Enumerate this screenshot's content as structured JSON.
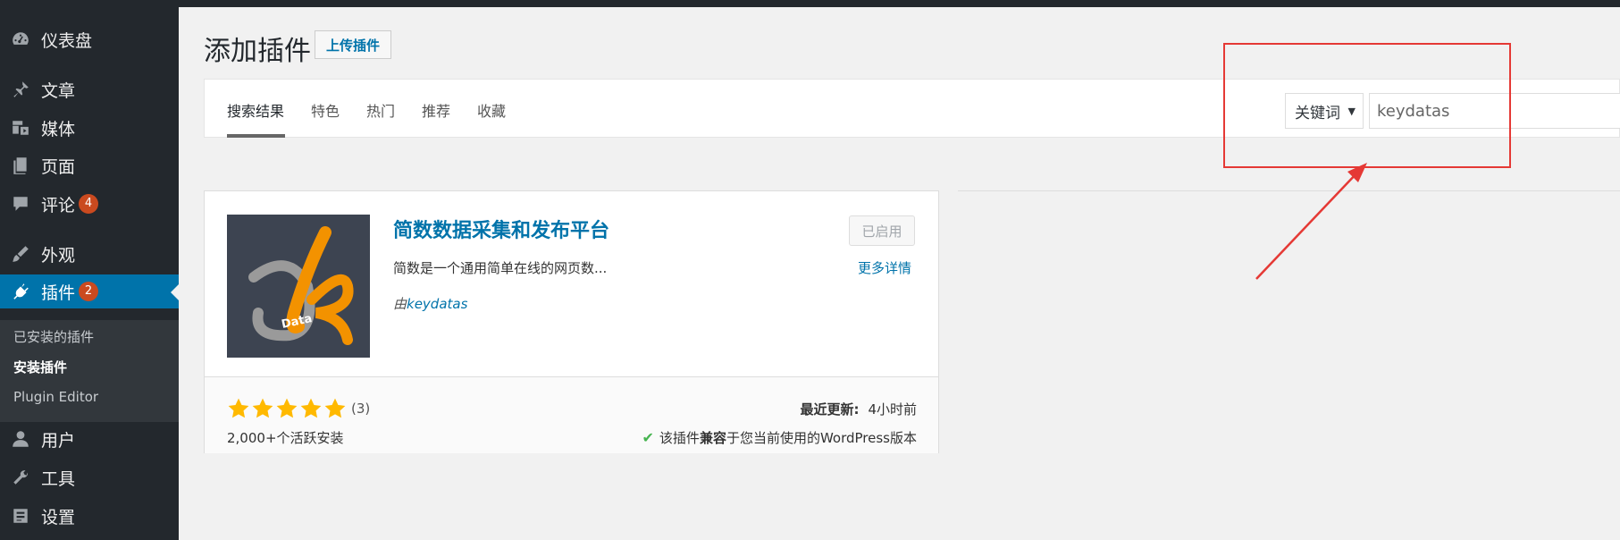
{
  "sidebar": {
    "items": [
      {
        "label": "仪表盘",
        "icon": "dashboard-icon"
      },
      {
        "label": "文章",
        "icon": "pin-icon"
      },
      {
        "label": "媒体",
        "icon": "media-icon"
      },
      {
        "label": "页面",
        "icon": "pages-icon"
      },
      {
        "label": "评论",
        "icon": "comment-icon",
        "badge": "4"
      },
      {
        "label": "外观",
        "icon": "brush-icon"
      },
      {
        "label": "插件",
        "icon": "plugin-icon",
        "badge": "2"
      },
      {
        "label": "用户",
        "icon": "user-icon"
      },
      {
        "label": "工具",
        "icon": "wrench-icon"
      },
      {
        "label": "设置",
        "icon": "settings-icon"
      }
    ],
    "submenu": [
      "已安装的插件",
      "安装插件",
      "Plugin Editor"
    ]
  },
  "header": {
    "title": "添加插件",
    "upload_label": "上传插件"
  },
  "tabs": [
    "搜索结果",
    "特色",
    "热门",
    "推荐",
    "收藏"
  ],
  "search": {
    "type_label": "关键词",
    "value": "keydatas"
  },
  "plugin": {
    "name": "简数数据采集和发布平台",
    "description": "简数是一个通用简单在线的网页数...",
    "author_prefix": "由",
    "author": "keydatas",
    "status_label": "已启用",
    "more_label": "更多详情",
    "rating": 5,
    "rating_count": "(3)",
    "installs": "2,000+个活跃安装",
    "updated_label": "最近更新:",
    "updated_value": "4小时前",
    "compat_pre": "该插件",
    "compat_bold": "兼容",
    "compat_post": "于您当前使用的WordPress版本",
    "icon_text": "Data"
  },
  "colors": {
    "sidebar_bg": "#23282d",
    "active": "#0073aa",
    "badge": "#ca4a1f",
    "star": "#ffb900",
    "annotation": "#e53935"
  }
}
